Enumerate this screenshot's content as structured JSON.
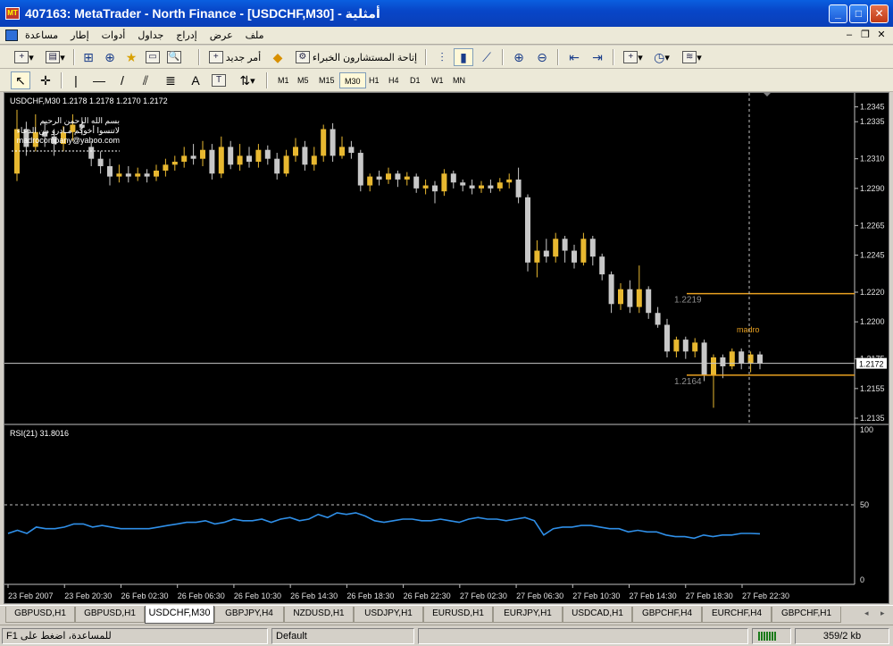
{
  "window": {
    "title": "407163: MetaTrader - North Finance - [USDCHF,M30] - أمثلية",
    "app_icon_text": "MT"
  },
  "menu": {
    "items": [
      "ملف",
      "عرض",
      "إدراج",
      "جداول",
      "أدوات",
      "إطار",
      "مساعدة"
    ]
  },
  "toolbar1": {
    "new_order_label": "أمر جديد",
    "expert_advisors_label": "إتاحة المستشارون الخبراء"
  },
  "toolbar2": {
    "timeframes": [
      "M1",
      "M5",
      "M15",
      "M30",
      "H1",
      "H4",
      "D1",
      "W1",
      "MN"
    ],
    "active_timeframe": "M30",
    "text_tool_label": "A"
  },
  "chart": {
    "symbol_header": "USDCHF,M30  1.2178 1.2178 1.2170 1.2172",
    "overlay_text": [
      "بسم الله الرحمن الرحيم",
      "لاتنسوا أخوكم مـادرو من الدعاء",
      "madrocompany@yahoo.com"
    ],
    "current_price": "1.2172",
    "annotation_upper": "1.2219",
    "annotation_lower": "1.2164",
    "annotation_brand": "madro",
    "indicator_header": "RSI(21) 31.8016",
    "colors": {
      "background": "#000000",
      "bull_candle": "#e8b830",
      "bear_candle": "#c8c8c8",
      "rsi_line": "#2f8fe8",
      "annotation": "#e8a020"
    }
  },
  "chart_data": {
    "type": "candlestick",
    "symbol": "USDCHF",
    "timeframe": "M30",
    "price_axis_ticks": [
      1.2345,
      1.2335,
      1.231,
      1.229,
      1.2265,
      1.2245,
      1.222,
      1.22,
      1.2175,
      1.2155,
      1.2135
    ],
    "ylim": [
      1.2132,
      1.2352
    ],
    "time_axis_labels": [
      "23 Feb 2007",
      "23 Feb 20:30",
      "26 Feb 02:30",
      "26 Feb 06:30",
      "26 Feb 10:30",
      "26 Feb 14:30",
      "26 Feb 18:30",
      "26 Feb 22:30",
      "27 Feb 02:30",
      "27 Feb 06:30",
      "27 Feb 10:30",
      "27 Feb 14:30",
      "27 Feb 18:30",
      "27 Feb 22:30"
    ],
    "candles": [
      [
        1.23,
        1.233,
        1.2343,
        1.2295
      ],
      [
        1.233,
        1.2318,
        1.2335,
        1.2312
      ],
      [
        1.2318,
        1.2328,
        1.234,
        1.2315
      ],
      [
        1.2328,
        1.2325,
        1.2335,
        1.2318
      ],
      [
        1.2325,
        1.232,
        1.233,
        1.2312
      ],
      [
        1.232,
        1.2328,
        1.2332,
        1.2315
      ],
      [
        1.2328,
        1.2333,
        1.234,
        1.2322
      ],
      [
        1.2333,
        1.2331,
        1.2338,
        1.2326
      ],
      [
        1.2318,
        1.231,
        1.2322,
        1.2305
      ],
      [
        1.231,
        1.2305,
        1.2315,
        1.23
      ],
      [
        1.2305,
        1.2298,
        1.231,
        1.2292
      ],
      [
        1.2298,
        1.23,
        1.2306,
        1.2294
      ],
      [
        1.23,
        1.2298,
        1.2305,
        1.2294
      ],
      [
        1.2298,
        1.23,
        1.2304,
        1.2295
      ],
      [
        1.23,
        1.2298,
        1.2303,
        1.2294
      ],
      [
        1.2298,
        1.2302,
        1.2306,
        1.2295
      ],
      [
        1.2302,
        1.2306,
        1.231,
        1.2298
      ],
      [
        1.2306,
        1.2308,
        1.2312,
        1.2302
      ],
      [
        1.2308,
        1.2312,
        1.2318,
        1.2304
      ],
      [
        1.2312,
        1.231,
        1.232,
        1.2306
      ],
      [
        1.231,
        1.2316,
        1.2322,
        1.2305
      ],
      [
        1.2316,
        1.23,
        1.232,
        1.2296
      ],
      [
        1.23,
        1.2318,
        1.2325,
        1.2297
      ],
      [
        1.2318,
        1.2306,
        1.2322,
        1.2303
      ],
      [
        1.2306,
        1.2312,
        1.232,
        1.2302
      ],
      [
        1.2312,
        1.2308,
        1.2318,
        1.2304
      ],
      [
        1.2308,
        1.2316,
        1.232,
        1.2304
      ],
      [
        1.2316,
        1.231,
        1.2319,
        1.2306
      ],
      [
        1.231,
        1.23,
        1.2314,
        1.2296
      ],
      [
        1.23,
        1.2312,
        1.2316,
        1.2298
      ],
      [
        1.2312,
        1.2318,
        1.2324,
        1.2308
      ],
      [
        1.2318,
        1.2306,
        1.2322,
        1.2302
      ],
      [
        1.2306,
        1.2312,
        1.2318,
        1.2302
      ],
      [
        1.2312,
        1.233,
        1.2333,
        1.2308
      ],
      [
        1.233,
        1.2312,
        1.2334,
        1.2308
      ],
      [
        1.2312,
        1.2318,
        1.2325,
        1.231
      ],
      [
        1.2318,
        1.2314,
        1.2322,
        1.231
      ],
      [
        1.2314,
        1.2292,
        1.2316,
        1.2288
      ],
      [
        1.2292,
        1.2298,
        1.23,
        1.2288
      ],
      [
        1.2298,
        1.2296,
        1.2302,
        1.2292
      ],
      [
        1.2296,
        1.23,
        1.2304,
        1.2293
      ],
      [
        1.23,
        1.2296,
        1.2302,
        1.2291
      ],
      [
        1.2296,
        1.2298,
        1.2301,
        1.2292
      ],
      [
        1.2298,
        1.229,
        1.23,
        1.2287
      ],
      [
        1.229,
        1.2292,
        1.2296,
        1.2286
      ],
      [
        1.2292,
        1.2288,
        1.2295,
        1.228
      ],
      [
        1.2288,
        1.23,
        1.2303,
        1.2285
      ],
      [
        1.23,
        1.2294,
        1.2302,
        1.229
      ],
      [
        1.2294,
        1.2292,
        1.2296,
        1.2288
      ],
      [
        1.2292,
        1.229,
        1.2296,
        1.2286
      ],
      [
        1.229,
        1.2292,
        1.2295,
        1.2287
      ],
      [
        1.2292,
        1.229,
        1.2296,
        1.2287
      ],
      [
        1.229,
        1.2294,
        1.2297,
        1.2288
      ],
      [
        1.2294,
        1.2296,
        1.23,
        1.229
      ],
      [
        1.2296,
        1.2284,
        1.2304,
        1.228
      ],
      [
        1.2284,
        1.224,
        1.2286,
        1.2234
      ],
      [
        1.224,
        1.2248,
        1.2255,
        1.223
      ],
      [
        1.2248,
        1.2244,
        1.2256,
        1.224
      ],
      [
        1.2244,
        1.2256,
        1.226,
        1.224
      ],
      [
        1.2256,
        1.2248,
        1.2258,
        1.224
      ],
      [
        1.2248,
        1.224,
        1.2252,
        1.2236
      ],
      [
        1.224,
        1.2256,
        1.226,
        1.2238
      ],
      [
        1.2256,
        1.2244,
        1.2258,
        1.2238
      ],
      [
        1.2244,
        1.2232,
        1.2246,
        1.2228
      ],
      [
        1.2232,
        1.2212,
        1.2234,
        1.2206
      ],
      [
        1.2212,
        1.2222,
        1.2226,
        1.2208
      ],
      [
        1.2222,
        1.221,
        1.2228,
        1.2206
      ],
      [
        1.221,
        1.2222,
        1.2238,
        1.2206
      ],
      [
        1.2222,
        1.2206,
        1.2224,
        1.2202
      ],
      [
        1.2206,
        1.2198,
        1.221,
        1.2196
      ],
      [
        1.2198,
        1.218,
        1.2202,
        1.2176
      ],
      [
        1.218,
        1.2188,
        1.219,
        1.2176
      ],
      [
        1.2188,
        1.218,
        1.219,
        1.2175
      ],
      [
        1.218,
        1.2186,
        1.2189,
        1.2176
      ],
      [
        1.2186,
        1.2164,
        1.2188,
        1.216
      ],
      [
        1.2164,
        1.2176,
        1.2178,
        1.2142
      ],
      [
        1.2176,
        1.217,
        1.2178,
        1.2162
      ],
      [
        1.217,
        1.218,
        1.2182,
        1.2168
      ],
      [
        1.218,
        1.2172,
        1.2182,
        1.2168
      ],
      [
        1.2172,
        1.2178,
        1.218,
        1.2166
      ],
      [
        1.2178,
        1.2172,
        1.218,
        1.2168
      ]
    ],
    "horizontal_levels": [
      1.2219,
      1.2164,
      1.2172
    ],
    "indicator": {
      "name": "RSI(21)",
      "last_value": 31.8016,
      "axis_ticks": [
        100,
        50,
        0
      ],
      "ylim": [
        0,
        100
      ],
      "level": 50,
      "values": [
        32,
        34,
        32,
        36,
        35,
        35,
        36,
        38,
        38,
        36,
        37,
        36,
        35,
        35,
        35,
        35,
        36,
        37,
        38,
        39,
        39,
        40,
        38,
        39,
        41,
        40,
        40,
        41,
        39,
        41,
        42,
        40,
        41,
        44,
        42,
        45,
        44,
        45,
        43,
        40,
        39,
        40,
        41,
        41,
        40,
        40,
        41,
        40,
        39,
        41,
        42,
        41,
        41,
        40,
        41,
        42,
        40,
        31,
        35,
        36,
        36,
        37,
        37,
        36,
        35,
        35,
        33,
        34,
        33,
        33,
        31,
        30,
        30,
        29,
        31,
        30,
        31,
        31,
        32,
        32,
        31.8
      ]
    }
  },
  "symbol_tabs": {
    "items": [
      "GBPUSD,H1",
      "GBPUSD,H1",
      "USDCHF,M30",
      "GBPJPY,H4",
      "NZDUSD,H1",
      "USDJPY,H1",
      "EURUSD,H1",
      "EURJPY,H1",
      "USDCAD,H1",
      "GBPCHF,H4",
      "EURCHF,H4",
      "GBPCHF,H1"
    ],
    "active": "USDCHF,M30",
    "prev_arrow": "◂",
    "next_arrow": "▸"
  },
  "statusbar": {
    "help_text": "للمساعدة، اضغط على F1",
    "profile": "Default",
    "traffic": "359/2 kb"
  }
}
